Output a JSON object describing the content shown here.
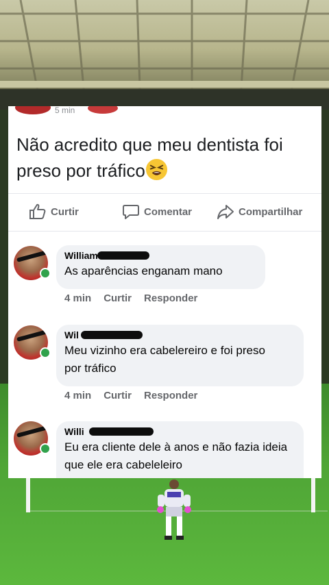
{
  "post": {
    "time": "5 min",
    "text": "Não acredito que meu dentista foi preso por tráfico",
    "emoji": "tired-face-emoji"
  },
  "actions": {
    "like": "Curtir",
    "comment": "Comentar",
    "share": "Compartilhar"
  },
  "comments": [
    {
      "name": "William",
      "text": "As aparências enganam mano",
      "time": "4 min",
      "like": "Curtir",
      "reply": "Responder"
    },
    {
      "name": "Wil",
      "text": "Meu vizinho era cabelereiro e foi preso por tráfico",
      "time": "4 min",
      "like": "Curtir",
      "reply": "Responder"
    },
    {
      "name": "Willi",
      "text": "Eu era cliente dele à anos e não fazia ideia que ele era cabeleleiro"
    }
  ],
  "colors": {
    "card": "#ffffff",
    "bubble": "#f0f2f5",
    "meta": "#65676b",
    "online": "#31a24c",
    "pitch": "#4fa536"
  }
}
